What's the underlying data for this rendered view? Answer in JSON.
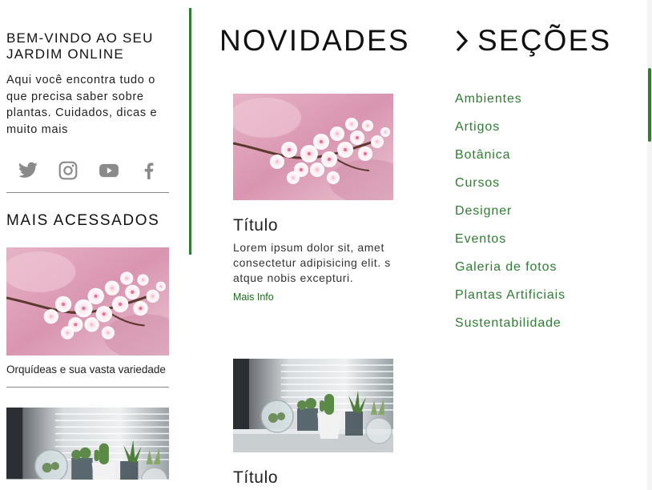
{
  "sidebar": {
    "welcome_title": "BEM-VINDO AO SEU JARDIM ONLINE",
    "welcome_text": "Aqui você encontra tudo o que precisa saber sobre plantas. Cuidados, dicas e muito mais",
    "social_icons": [
      "twitter-icon",
      "instagram-icon",
      "youtube-icon",
      "facebook-icon"
    ],
    "most_accessed_title": "MAIS ACESSADOS",
    "most_accessed": [
      {
        "image": "cherry-blossom-photo",
        "caption": "Orquídeas e sua vasta variedade"
      },
      {
        "image": "succulents-window-photo",
        "caption": ""
      }
    ]
  },
  "news": {
    "title": "NOVIDADES",
    "cards": [
      {
        "image": "cherry-blossom-photo",
        "title": "Título",
        "text": "Lorem ipsum dolor sit, amet consectetur adipisicing elit. s atque nobis excepturi.",
        "link": "Mais Info"
      },
      {
        "image": "succulents-window-photo",
        "title": "Título",
        "text": "",
        "link": ""
      }
    ]
  },
  "sections": {
    "title": "SEÇÕES",
    "items": [
      "Ambientes",
      "Artigos",
      "Botânica",
      "Cursos",
      "Designer",
      "Eventos",
      "Galeria de fotos",
      "Plantas Artificiais",
      "Sustentabilidade"
    ]
  },
  "colors": {
    "accent_green": "#2e7d32",
    "link_green": "#1b6b1b",
    "icon_gray": "#8a8a8a",
    "text": "#222222"
  }
}
